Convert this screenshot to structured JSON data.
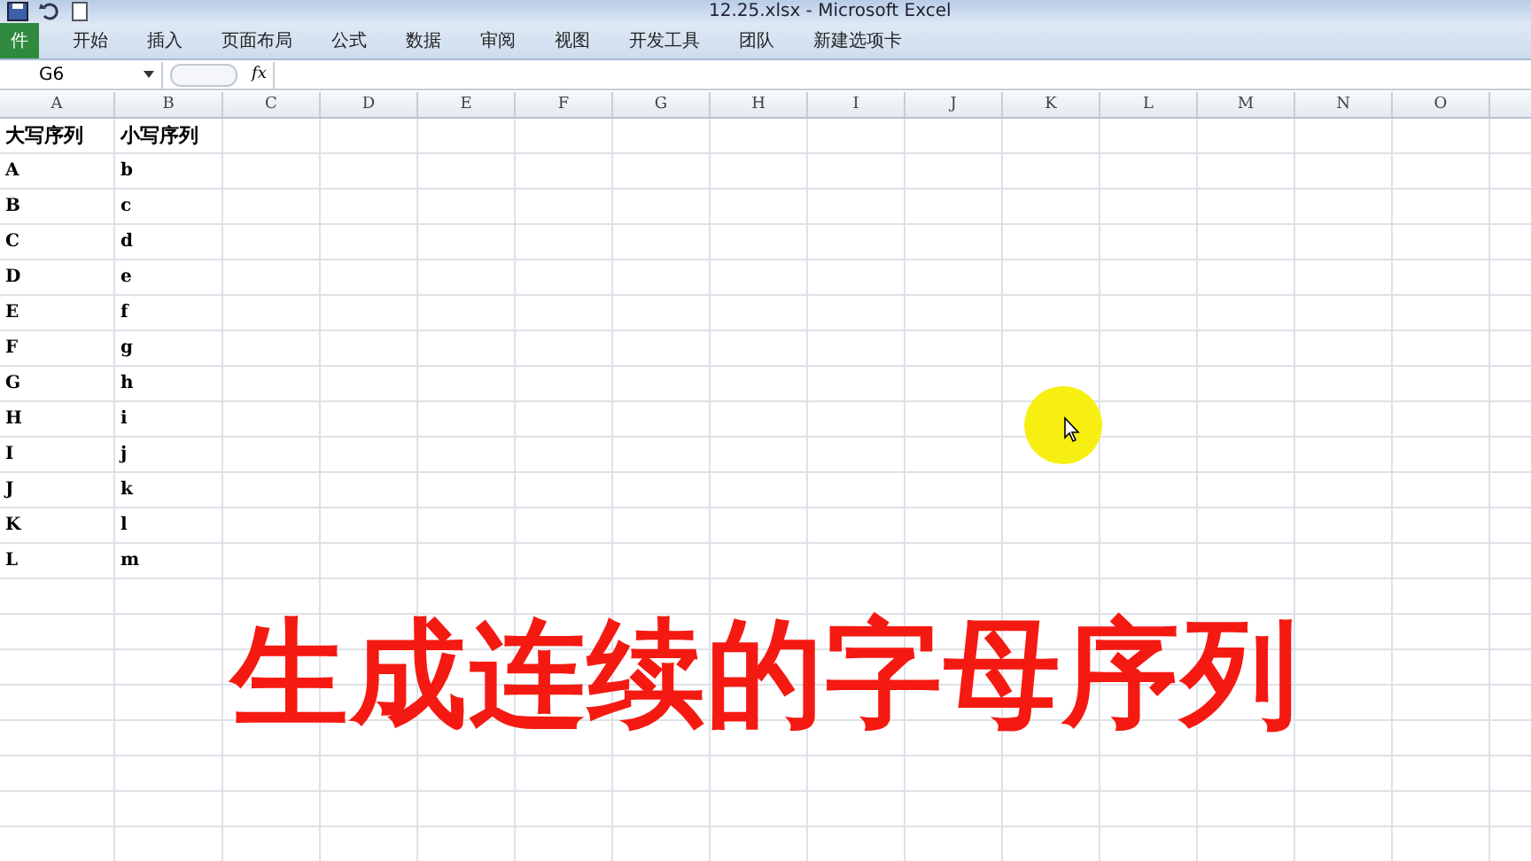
{
  "window": {
    "title": "12.25.xlsx - Microsoft Excel"
  },
  "ribbon_tabs": [
    {
      "label": "件",
      "kind": "file"
    },
    {
      "label": "开始",
      "kind": "tab"
    },
    {
      "label": "插入",
      "kind": "tab"
    },
    {
      "label": "页面布局",
      "kind": "tab"
    },
    {
      "label": "公式",
      "kind": "tab"
    },
    {
      "label": "数据",
      "kind": "tab"
    },
    {
      "label": "审阅",
      "kind": "tab"
    },
    {
      "label": "视图",
      "kind": "tab"
    },
    {
      "label": "开发工具",
      "kind": "tab"
    },
    {
      "label": "团队",
      "kind": "tab"
    },
    {
      "label": "新建选项卡",
      "kind": "tab"
    }
  ],
  "name_box": "G6",
  "formula_bar": {
    "function_label": "fx"
  },
  "columns": [
    "A",
    "B",
    "C",
    "D",
    "E",
    "F",
    "G",
    "H",
    "I",
    "J",
    "K",
    "L",
    "M",
    "N",
    "O"
  ],
  "rows": [
    [
      "大写序列",
      "小写序列"
    ],
    [
      "A",
      "b"
    ],
    [
      "B",
      "c"
    ],
    [
      "C",
      "d"
    ],
    [
      "D",
      "e"
    ],
    [
      "E",
      "f"
    ],
    [
      "F",
      "g"
    ],
    [
      "G",
      "h"
    ],
    [
      "H",
      "i"
    ],
    [
      "I",
      "j"
    ],
    [
      "J",
      "k"
    ],
    [
      "K",
      "l"
    ],
    [
      "L",
      "m"
    ]
  ],
  "caption": "生成连续的字母序列"
}
